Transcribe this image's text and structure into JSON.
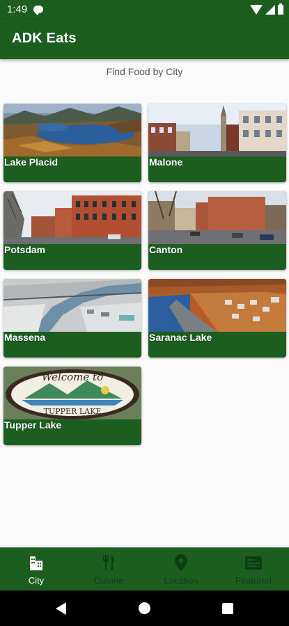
{
  "status_bar": {
    "time": "1:49"
  },
  "app_bar": {
    "title": "ADK Eats"
  },
  "header": {
    "subtitle": "Find Food by City"
  },
  "cities": [
    {
      "label": "Lake Placid"
    },
    {
      "label": "Malone"
    },
    {
      "label": "Potsdam"
    },
    {
      "label": "Canton"
    },
    {
      "label": "Massena"
    },
    {
      "label": "Saranac Lake"
    },
    {
      "label": "Tupper Lake",
      "sign_line1": "Welcome to",
      "sign_line2": "TUPPER LAKE"
    }
  ],
  "bottom_nav": {
    "items": [
      {
        "label": "City",
        "icon": "city-icon",
        "active": true
      },
      {
        "label": "Cuisine",
        "icon": "cutlery-icon",
        "active": false
      },
      {
        "label": "Location",
        "icon": "location-pin-icon",
        "active": false
      },
      {
        "label": "Featured",
        "icon": "featured-icon",
        "active": false
      }
    ]
  },
  "colors": {
    "primary": "#1b5e20",
    "inactive_nav": "#0f3d13",
    "background": "#fafafa"
  }
}
